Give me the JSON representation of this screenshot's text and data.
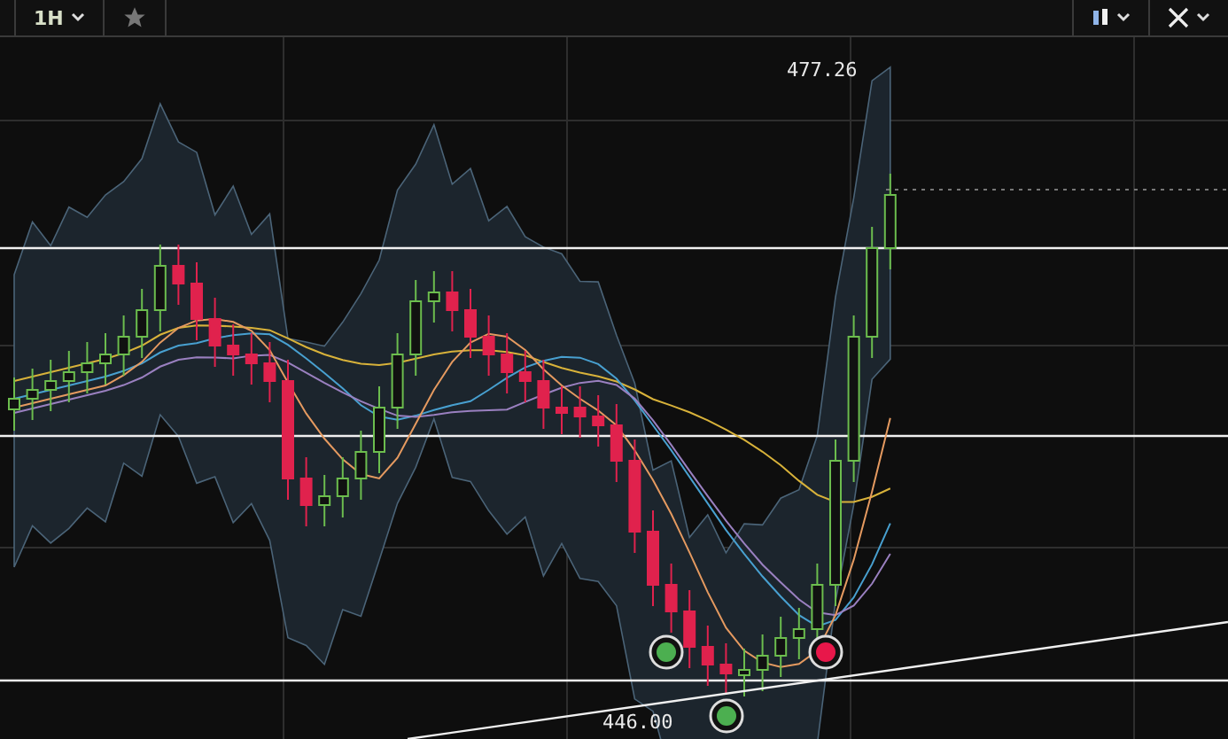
{
  "toolbar": {
    "interval": "1H"
  },
  "chart": {
    "high_label": "477.26",
    "low_label": "446.00",
    "signals": [
      {
        "color": "#4caf50"
      },
      {
        "color": "#4caf50"
      },
      {
        "color": "#e8174a"
      }
    ]
  }
}
